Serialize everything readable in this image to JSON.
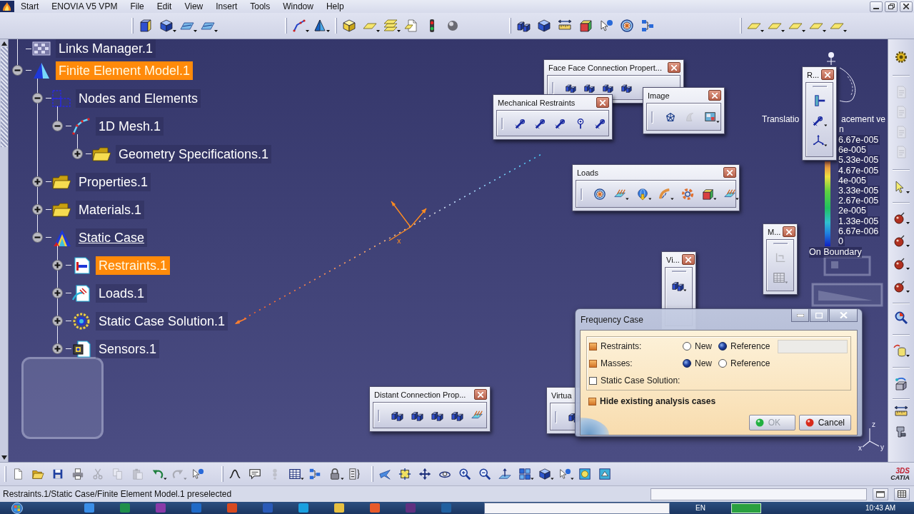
{
  "menu_bar": {
    "items": [
      {
        "label": "Start"
      },
      {
        "label": "ENOVIA V5 VPM"
      },
      {
        "label": "File"
      },
      {
        "label": "Edit"
      },
      {
        "label": "View"
      },
      {
        "label": "Insert"
      },
      {
        "label": "Tools"
      },
      {
        "label": "Window"
      },
      {
        "label": "Help"
      }
    ]
  },
  "tree": [
    {
      "label": "Links Manager.1",
      "kind": "links",
      "selected": false,
      "current": false
    },
    {
      "label": "Finite Element Model.1",
      "kind": "model",
      "expanded": true,
      "selected": true,
      "current": false,
      "children": [
        {
          "label": "Nodes and Elements",
          "kind": "nodes",
          "expanded": true,
          "selected": false,
          "current": false,
          "children": [
            {
              "label": "1D Mesh.1",
              "kind": "mesh",
              "expanded": true,
              "selected": false,
              "current": false,
              "children": [
                {
                  "label": "Geometry Specifications.1",
                  "kind": "folder",
                  "expanded": false,
                  "selected": false,
                  "current": false
                }
              ]
            }
          ]
        },
        {
          "label": "Properties.1",
          "kind": "folder",
          "expanded": false,
          "selected": false,
          "current": false
        },
        {
          "label": "Materials.1",
          "kind": "folder",
          "expanded": false,
          "selected": false,
          "current": false
        },
        {
          "label": "Static Case",
          "kind": "case",
          "expanded": true,
          "selected": false,
          "current": true,
          "children": [
            {
              "label": "Restraints.1",
              "kind": "restraints",
              "expanded": false,
              "selected": true,
              "current": false
            },
            {
              "label": "Loads.1",
              "kind": "loads",
              "expanded": false,
              "selected": false,
              "current": false
            },
            {
              "label": "Static Case Solution.1",
              "kind": "solution",
              "expanded": false,
              "selected": false,
              "current": false
            },
            {
              "label": "Sensors.1",
              "kind": "sensors",
              "expanded": false,
              "selected": false,
              "current": false
            }
          ]
        }
      ]
    }
  ],
  "canvas": {
    "axis_label": "x",
    "triad_labels": [
      "z",
      "x",
      "y"
    ]
  },
  "floating_toolbars": [
    {
      "title": "Face Face Connection Propert...",
      "buttons": [
        {
          "disabled": false
        },
        {
          "disabled": false
        },
        {
          "disabled": false
        },
        {
          "disabled": false
        }
      ]
    },
    {
      "title": "Mechanical Restraints",
      "buttons": [
        {
          "disabled": false
        },
        {
          "disabled": false
        },
        {
          "disabled": false
        },
        {
          "disabled": false
        },
        {
          "disabled": false
        }
      ]
    },
    {
      "title": "Image",
      "buttons": [
        {
          "disabled": false
        },
        {
          "disabled": true
        },
        {
          "disabled": false
        }
      ]
    },
    {
      "title": "Loads",
      "buttons": [
        {
          "disabled": false
        },
        {
          "disabled": false
        },
        {
          "disabled": false
        },
        {
          "disabled": false
        },
        {
          "disabled": false
        },
        {
          "disabled": false
        },
        {
          "disabled": false
        }
      ]
    },
    {
      "title": "R...",
      "buttons": [
        {
          "disabled": false
        },
        {
          "disabled": false
        },
        {
          "disabled": false
        }
      ]
    },
    {
      "title": "M...",
      "buttons": [
        {
          "disabled": true
        },
        {
          "disabled": true
        }
      ]
    },
    {
      "title": "Vi...",
      "buttons": [
        {
          "disabled": false
        }
      ]
    },
    {
      "title": "Distant Connection Prop...",
      "buttons": [
        {
          "disabled": false
        },
        {
          "disabled": false
        },
        {
          "disabled": false
        },
        {
          "disabled": false
        },
        {
          "disabled": false
        }
      ]
    },
    {
      "title": "Virtua",
      "buttons": [
        {
          "disabled": false
        }
      ]
    }
  ],
  "legend": {
    "title": "Translatio",
    "title_continued": "acement ve",
    "unit": "n",
    "values": [
      "6.67e-005",
      "6e-005",
      "5.33e-005",
      "4.67e-005",
      "4e-005",
      "3.33e-005",
      "2.67e-005",
      "2e-005",
      "1.33e-005",
      "6.67e-006",
      "0"
    ],
    "footer": "On Boundary"
  },
  "dialog": {
    "title": "Frequency Case",
    "rows": [
      {
        "label": "Restraints:",
        "checked": true,
        "options": [
          {
            "label": "New",
            "selected": false
          },
          {
            "label": "Reference",
            "selected": true
          }
        ],
        "field": {
          "disabled": true
        }
      },
      {
        "label": "Masses:",
        "checked": true,
        "options": [
          {
            "label": "New",
            "selected": true
          },
          {
            "label": "Reference",
            "selected": false
          }
        ]
      },
      {
        "label": "Static Case Solution:",
        "checked": false
      }
    ],
    "hide_option": {
      "label": "Hide existing analysis cases",
      "checked": true
    },
    "buttons": [
      {
        "label": "OK",
        "kind": "ok",
        "disabled": true
      },
      {
        "label": "Cancel",
        "kind": "cancel",
        "disabled": false
      }
    ]
  },
  "right_toolbar": {
    "buttons": [
      {
        "disabled": false
      },
      {
        "disabled": true
      },
      {
        "disabled": true
      },
      {
        "disabled": true
      },
      {
        "disabled": true
      },
      {
        "disabled": false
      },
      {
        "disabled": false
      },
      {
        "disabled": false
      },
      {
        "disabled": false
      },
      {
        "disabled": false
      },
      {
        "disabled": false
      },
      {
        "disabled": false
      },
      {
        "disabled": false
      },
      {
        "disabled": false
      },
      {
        "disabled": false
      }
    ]
  },
  "bottom_toolbar": {
    "buttons": [
      {
        "disabled": false
      },
      {
        "disabled": false
      },
      {
        "disabled": false
      },
      {
        "disabled": false
      },
      {
        "disabled": true
      },
      {
        "disabled": true
      },
      {
        "disabled": true
      },
      {
        "disabled": false
      },
      {
        "disabled": true
      },
      {
        "disabled": false
      },
      {
        "disabled": false
      },
      {
        "disabled": false
      },
      {
        "disabled": true
      },
      {
        "disabled": false
      },
      {
        "disabled": false
      },
      {
        "disabled": false
      },
      {
        "disabled": false
      },
      {
        "disabled": false
      },
      {
        "disabled": false
      },
      {
        "disabled": false
      },
      {
        "disabled": false
      },
      {
        "disabled": false
      },
      {
        "disabled": false
      },
      {
        "disabled": false
      },
      {
        "disabled": false
      },
      {
        "disabled": false
      },
      {
        "disabled": false
      },
      {
        "disabled": false
      },
      {
        "disabled": false
      }
    ]
  },
  "logo": {
    "mark": "3DS",
    "name": "CATIA"
  },
  "status_bar": {
    "text": "Restraints.1/Static Case/Finite Element Model.1 preselected"
  },
  "taskbar": {
    "language": "EN",
    "clock": "10:43 AM"
  }
}
